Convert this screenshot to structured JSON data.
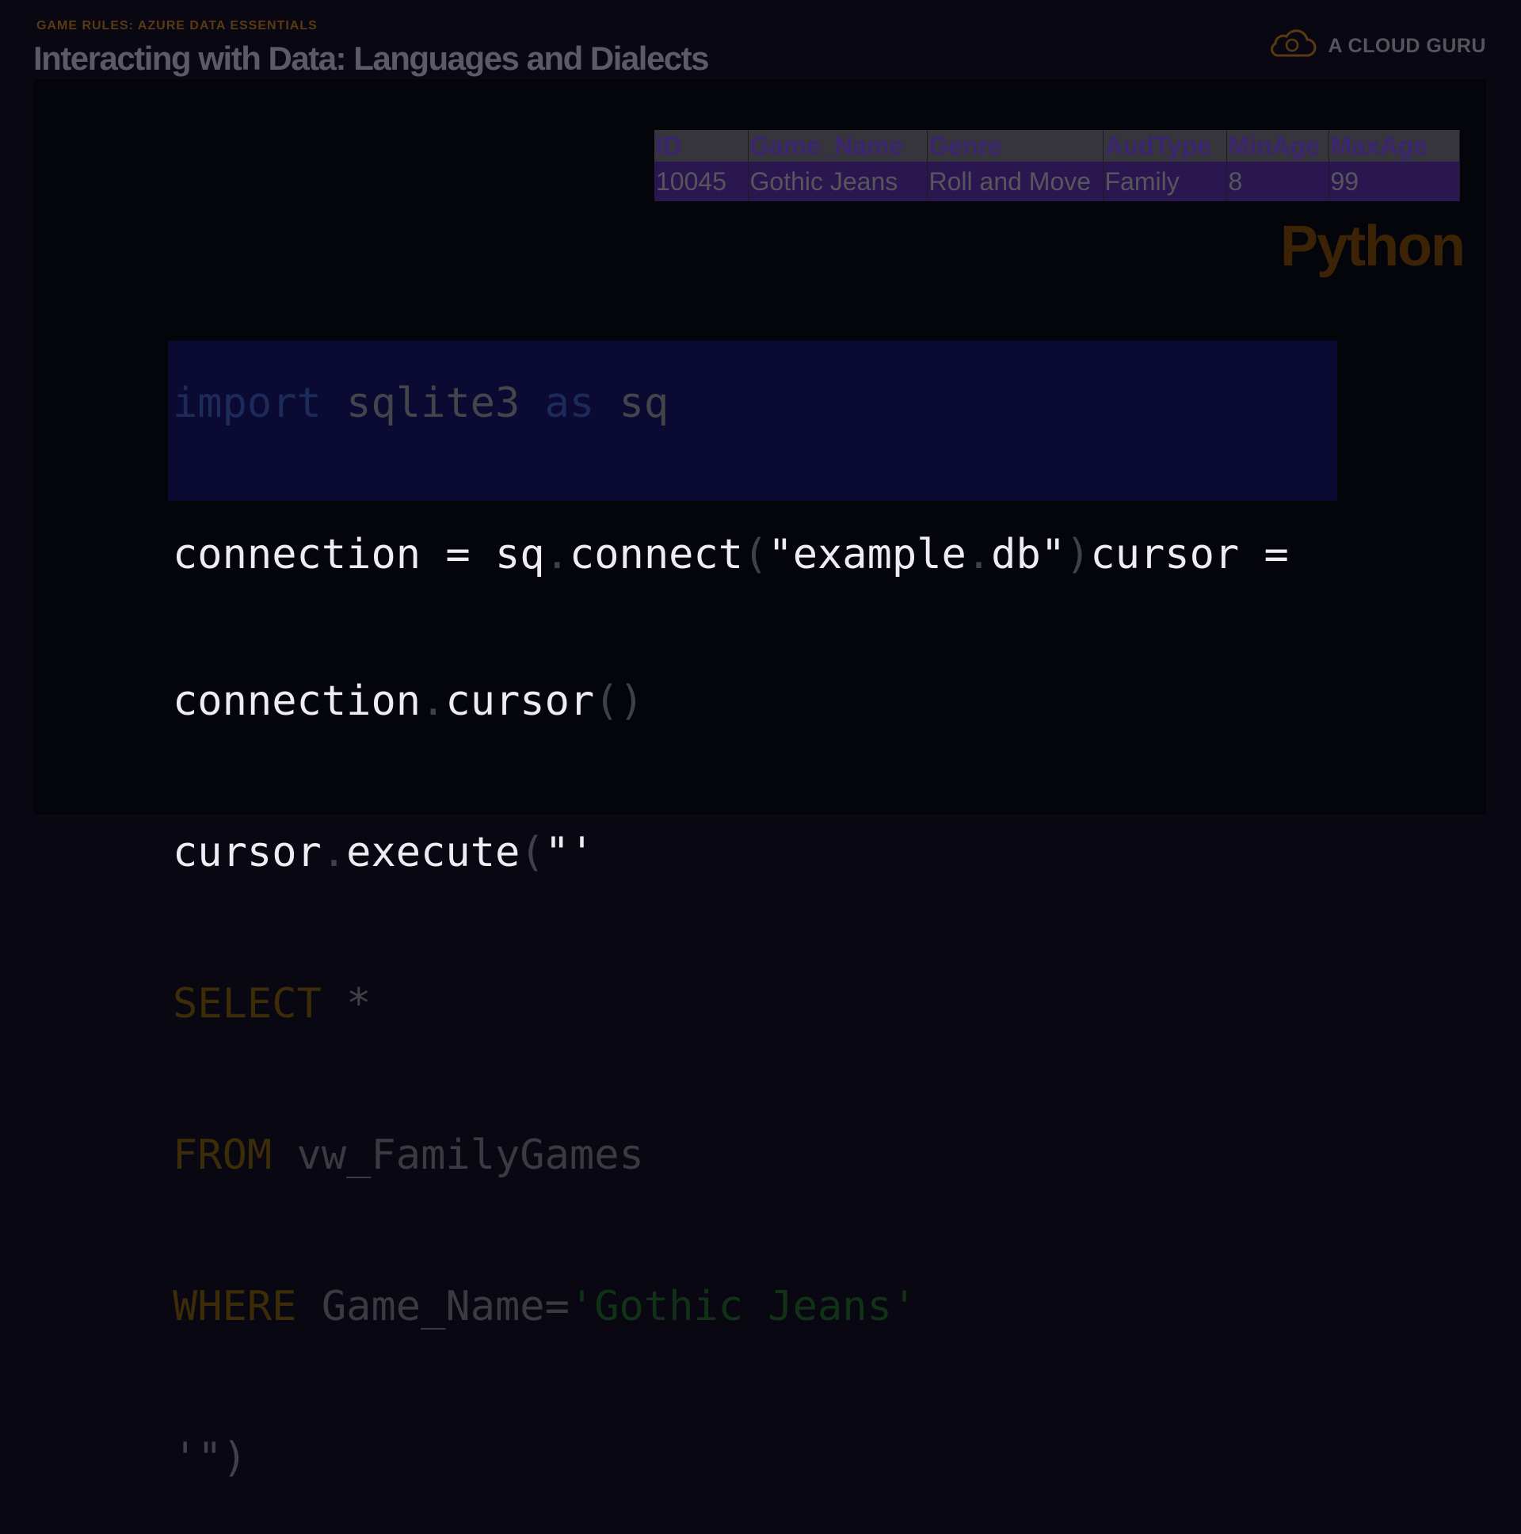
{
  "header": {
    "eyebrow": "GAME RULES: AZURE DATA ESSENTIALS",
    "title": "Interacting with Data: Languages and Dialects"
  },
  "brand": {
    "name": "A CLOUD GURU",
    "icon": "cloud-icon"
  },
  "table": {
    "columns": [
      "ID",
      "Game_Name",
      "Genre",
      "AudType",
      "MinAge",
      "MaxAge"
    ],
    "rows": [
      [
        "10045",
        "Gothic Jeans",
        "Roll and Move",
        "Family",
        "8",
        "99"
      ]
    ]
  },
  "language_label": "Python",
  "code": {
    "l1": {
      "kw_import": "import",
      "module": " sqlite3 ",
      "kw_as": "as",
      "alias": " sq"
    },
    "l2": {
      "a": "connection = sq",
      "b": ".",
      "c": "connect",
      "d": "(",
      "e": "\"example",
      "f": ".",
      "g": "db\"",
      "h": ")",
      "i": "cursor ="
    },
    "l3": {
      "a": "connection",
      "b": ".",
      "c": "cursor",
      "d": "()"
    },
    "l4": {
      "a": "cursor",
      "b": ".",
      "c": "execute",
      "d": "(",
      "e": "\"'"
    },
    "l5": {
      "kw": "SELECT",
      "rest": " *"
    },
    "l6": {
      "kw": "FROM",
      "rest": " vw_FamilyGames"
    },
    "l7": {
      "kw": "WHERE",
      "rest": " Game_Name=",
      "str": "'Gothic Jeans'"
    },
    "l8": {
      "a": "'\")"
    }
  },
  "colors": {
    "accent_orange": "#3d2306",
    "highlight_bg": "#0b0a33",
    "table_row": "#2a1750"
  }
}
